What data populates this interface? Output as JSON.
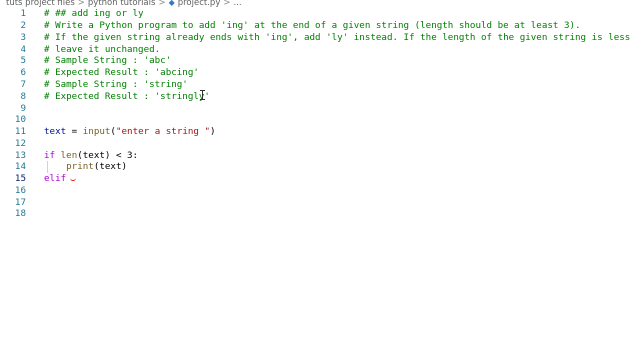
{
  "breadcrumb": {
    "items": [
      "tuts project files",
      "python tutorials",
      "project.py",
      "..."
    ],
    "separator": ">",
    "file_icon": "python-file-icon"
  },
  "editor": {
    "lines": [
      {
        "num": "1",
        "text": "# ## add ing or ly"
      },
      {
        "num": "2",
        "text": "# Write a Python program to add 'ing' at the end of a given string (length should be at least 3)."
      },
      {
        "num": "3",
        "text": "# If the given string already ends with 'ing', add 'ly' instead. If the length of the given string is less"
      },
      {
        "num": "4",
        "text": "# leave it unchanged."
      },
      {
        "num": "5",
        "text": "# Sample String : 'abc'"
      },
      {
        "num": "6",
        "text": "# Expected Result : 'abcing'"
      },
      {
        "num": "7",
        "text": "# Sample String : 'string'"
      },
      {
        "num": "8",
        "text": "# Expected Result : 'stringly'"
      },
      {
        "num": "9",
        "text": ""
      },
      {
        "num": "10",
        "text": ""
      },
      {
        "num": "11",
        "text": "text = input(\"enter a string \")"
      },
      {
        "num": "12",
        "text": ""
      },
      {
        "num": "13",
        "text": "if len(text) < 3:"
      },
      {
        "num": "14",
        "text": "    print(text)"
      },
      {
        "num": "15",
        "text": "elif"
      },
      {
        "num": "16",
        "text": ""
      },
      {
        "num": "17",
        "text": ""
      },
      {
        "num": "18",
        "text": ""
      }
    ],
    "tokens": {
      "l11_var": "text",
      "l11_eq": " = ",
      "l11_fn": "input",
      "l11_open": "(",
      "l11_str": "\"enter a string \"",
      "l11_close": ")",
      "l13_kw": "if",
      "l13_sp": " ",
      "l13_fn": "len",
      "l13_args": "(text) < 3:",
      "l14_indent": "    ",
      "l14_fn": "print",
      "l14_args": "(text)",
      "l15_kw": "elif"
    },
    "active_line": "15",
    "colors": {
      "comment": "#008000",
      "keyword": "#af00db",
      "function": "#795e26",
      "string": "#a31515",
      "line_number": "#237893",
      "error_squiggle": "#e51400"
    }
  }
}
